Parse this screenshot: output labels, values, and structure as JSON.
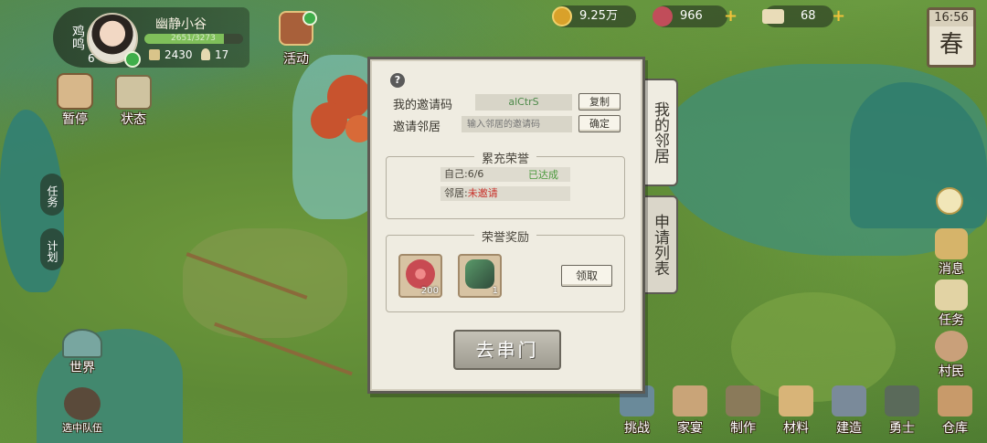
{
  "player": {
    "server": "鸡鸣",
    "level": "6",
    "name": "幽静小谷",
    "exp_text": "2651/3273",
    "exp_ratio": 0.81,
    "stat_a": "2430",
    "stat_b": "17"
  },
  "event": {
    "label": "活动"
  },
  "resources": {
    "coin": "9.25万",
    "jade": "966",
    "ticket": "68"
  },
  "clock": {
    "time": "16:56",
    "season": "春"
  },
  "left_menu": {
    "pause": "暂停",
    "status": "状态",
    "task_tab": "任务",
    "plan_tab": "计划",
    "world": "世界",
    "team": "选中队伍"
  },
  "right_menu": {
    "message": "消息",
    "quest": "任务",
    "villager": "村民"
  },
  "bottom_menu": [
    {
      "label": "挑战",
      "icon": "challenge-icon",
      "color": "#6a8a9a"
    },
    {
      "label": "家宴",
      "icon": "banquet-icon",
      "color": "#c9a478"
    },
    {
      "label": "制作",
      "icon": "craft-icon",
      "color": "#8a7a5a"
    },
    {
      "label": "材料",
      "icon": "material-icon",
      "color": "#d8b478"
    },
    {
      "label": "建造",
      "icon": "build-icon",
      "color": "#7a8a9a"
    },
    {
      "label": "勇士",
      "icon": "warrior-icon",
      "color": "#5a6a5a"
    },
    {
      "label": "仓库",
      "icon": "warehouse-icon",
      "color": "#c89a6a"
    }
  ],
  "dialog": {
    "invite_code_label": "我的邀请码",
    "invite_code_value": "alCtrS",
    "copy_button": "复制",
    "invite_neighbor_label": "邀请邻居",
    "invite_placeholder": "输入邻居的邀请码",
    "confirm_button": "确定",
    "honor_section_title": "累充荣誉",
    "self_progress": "自己:6/6",
    "self_status": "已达成",
    "neighbor_progress_prefix": "邻居:",
    "neighbor_status": "未邀请",
    "reward_section_title": "荣誉奖励",
    "reward_items": [
      {
        "icon": "jade-flower-icon",
        "qty": "200",
        "color": "#c84a52"
      },
      {
        "icon": "green-ore-icon",
        "qty": "1",
        "color": "#4a7a5a"
      }
    ],
    "claim_button": "领取",
    "go_button": "去串门",
    "tabs": [
      "我的邻居",
      "申请列表"
    ]
  },
  "colors": {
    "accent_green": "#4d9a3f",
    "alert_red": "#c8302a",
    "panel_bg": "#efece1"
  }
}
